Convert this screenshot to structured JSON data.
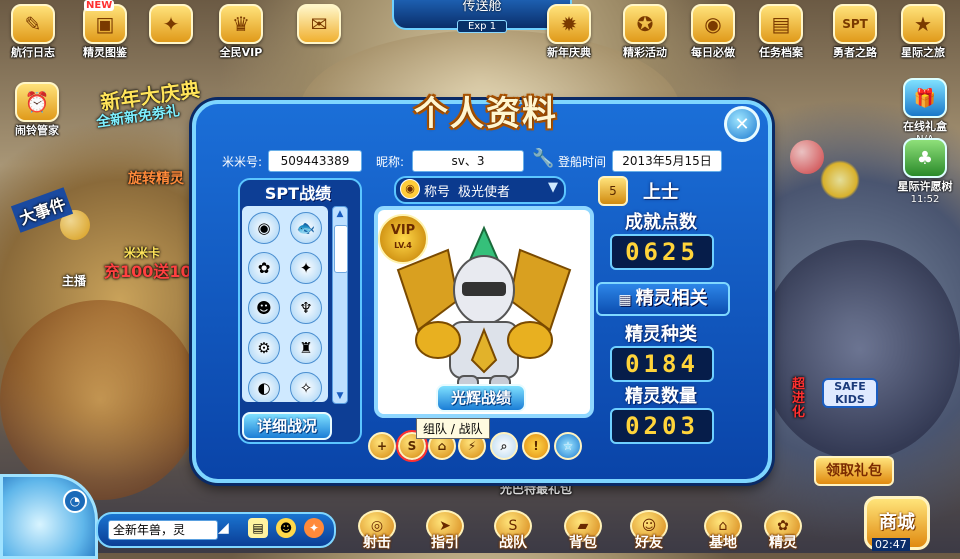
{
  "top_center": {
    "title": "传送舱",
    "exp": "Exp 1"
  },
  "top_buttons": [
    {
      "label": "航行日志",
      "icon": "logbook-icon",
      "glyph": "✎"
    },
    {
      "label": "精灵图鉴",
      "icon": "pokedex-icon",
      "glyph": "▣",
      "badge": "NEW"
    },
    {
      "label": "",
      "icon": "dragon-emblem-icon",
      "glyph": "✦"
    },
    {
      "label": "全民VIP",
      "icon": "vip-dragon-icon",
      "glyph": "♛"
    },
    {
      "label": "",
      "icon": "mail-icon",
      "glyph": "✉"
    },
    {
      "label": "新年庆典",
      "icon": "new-year-icon",
      "glyph": "✹"
    },
    {
      "label": "精彩活动",
      "icon": "events-icon",
      "glyph": "✪"
    },
    {
      "label": "每日必做",
      "icon": "daily-icon",
      "glyph": "◉"
    },
    {
      "label": "任务档案",
      "icon": "task-file-icon",
      "glyph": "▤"
    },
    {
      "label": "勇者之路",
      "icon": "spt-hero-icon",
      "glyph": "SPT"
    },
    {
      "label": "星际之旅",
      "icon": "star-travel-icon",
      "glyph": "★"
    }
  ],
  "left_buttons": [
    {
      "label": "闹铃管家",
      "icon": "alarm-icon",
      "glyph": "⏰"
    }
  ],
  "right_buttons": [
    {
      "label": "在线礼盒",
      "sub": "N/A",
      "icon": "online-gift-icon",
      "glyph": "🎁"
    },
    {
      "label": "星际许愿树",
      "sub": "11:52",
      "icon": "wish-tree-icon",
      "glyph": "♣"
    }
  ],
  "ads": {
    "new_year_line1": "新年大庆典",
    "new_year_line2": "全新新免劵礼",
    "event_tag": "大事件",
    "promo_1": "米米卡",
    "promo_2": "充100送10",
    "storm": "旋转精灵",
    "host_label": "主播",
    "super_evolve": "超进化",
    "safe_kids": "SAFE KIDS",
    "bottom_teaser": "光巴特最礼包"
  },
  "dialog": {
    "title": "个人资料",
    "fields": {
      "mimi_label": "米米号:",
      "mimi_value": "509443389",
      "nick_label": "昵称:",
      "nick_value": "sv、3",
      "boarding_label": "登船时间",
      "boarding_value": "2013年5月15日"
    },
    "spt": {
      "title": "SPT战绩",
      "detail_button": "详细战况",
      "cells": [
        {
          "glyph": "◉"
        },
        {
          "glyph": "🐟"
        },
        {
          "glyph": "✿"
        },
        {
          "glyph": "✦"
        },
        {
          "glyph": "☻"
        },
        {
          "glyph": "♆"
        },
        {
          "glyph": "⚙"
        },
        {
          "glyph": "♜"
        },
        {
          "glyph": "◐"
        },
        {
          "glyph": "✧"
        }
      ]
    },
    "title_bar": {
      "label": "称号",
      "value": "极光使者"
    },
    "vip": {
      "label": "VIP",
      "level": "LV.4"
    },
    "glory_button": "光辉战绩",
    "rank": "上士",
    "achievement_label": "成就点数",
    "achievement_value": "0625",
    "pet_section": "精灵相关",
    "pet_types_label": "精灵种类",
    "pet_types_value": "0184",
    "pet_count_label": "精灵数量",
    "pet_count_value": "0203",
    "actions": [
      {
        "icon": "add-friend-icon",
        "glyph": "+"
      },
      {
        "icon": "team-icon",
        "glyph": "S"
      },
      {
        "icon": "house-icon",
        "glyph": "⌂"
      },
      {
        "icon": "battle-icon",
        "glyph": "⚡"
      },
      {
        "icon": "search-icon",
        "glyph": "⌕"
      },
      {
        "icon": "report-icon",
        "glyph": "!"
      },
      {
        "icon": "rank-icon",
        "glyph": "☆"
      }
    ],
    "tooltip": "组队 / 战队"
  },
  "bottom": {
    "chat_value": "全新年兽，灵",
    "buttons": [
      {
        "label": "射击",
        "icon": "shoot-icon",
        "glyph": "◎"
      },
      {
        "label": "指引",
        "icon": "guide-icon",
        "glyph": "➤"
      },
      {
        "label": "战队",
        "icon": "team-s-icon",
        "glyph": "S"
      },
      {
        "label": "背包",
        "icon": "bag-icon",
        "glyph": "▰"
      },
      {
        "label": "好友",
        "icon": "friends-icon",
        "glyph": "☺"
      },
      {
        "label": "基地",
        "icon": "base-icon",
        "glyph": "⌂"
      },
      {
        "label": "精灵",
        "icon": "pet-icon",
        "glyph": "✿"
      }
    ],
    "gift_button": "领取礼包",
    "shop": "商城",
    "time": "02:47"
  }
}
